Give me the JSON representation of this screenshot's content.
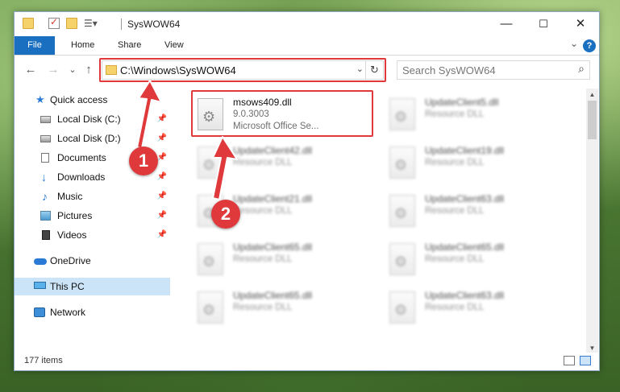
{
  "window": {
    "title": "SysWOW64",
    "minimize": "—",
    "maximize": "☐",
    "close": "✕"
  },
  "ribbon": {
    "tabs": [
      {
        "label": "File"
      },
      {
        "label": "Home"
      },
      {
        "label": "Share"
      },
      {
        "label": "View"
      }
    ],
    "help": "?"
  },
  "nav": {
    "back": "←",
    "forward": "→",
    "recent": "⌄",
    "up": "↑",
    "address": "C:\\Windows\\SysWOW64",
    "refresh": "↻",
    "search_placeholder": "Search SysWOW64",
    "search_icon": "search-icon"
  },
  "sidebar": {
    "items": [
      {
        "label": "Quick access",
        "icon": "star-icon",
        "pinned": false
      },
      {
        "label": "Local Disk (C:)",
        "icon": "drive-icon",
        "pinned": true
      },
      {
        "label": "Local Disk (D:)",
        "icon": "drive-icon",
        "pinned": true
      },
      {
        "label": "Documents",
        "icon": "documents-icon",
        "pinned": true
      },
      {
        "label": "Downloads",
        "icon": "download-icon",
        "pinned": true
      },
      {
        "label": "Music",
        "icon": "music-icon",
        "pinned": true
      },
      {
        "label": "Pictures",
        "icon": "pictures-icon",
        "pinned": true
      },
      {
        "label": "Videos",
        "icon": "videos-icon",
        "pinned": true
      },
      {
        "label": "OneDrive",
        "icon": "cloud-icon",
        "pinned": false
      },
      {
        "label": "This PC",
        "icon": "computer-icon",
        "pinned": false,
        "selected": true
      },
      {
        "label": "Network",
        "icon": "network-icon",
        "pinned": false
      }
    ]
  },
  "files": [
    {
      "name": "msows409.dll",
      "line2": "9.0.3003",
      "line3": "Microsoft Office Se...",
      "highlighted": true
    },
    {
      "name": "UpdateClient5.dll",
      "line2": "Resource DLL",
      "blurred": true
    },
    {
      "name": "UpdateClient42.dll",
      "line2": "Resource DLL",
      "blurred": true
    },
    {
      "name": "UpdateClient19.dll",
      "line2": "Resource DLL",
      "blurred": true
    },
    {
      "name": "UpdateClient21.dll",
      "line2": "Resource DLL",
      "blurred": true
    },
    {
      "name": "UpdateClient63.dll",
      "line2": "Resource DLL",
      "blurred": true
    },
    {
      "name": "UpdateClient65.dll",
      "line2": "Resource DLL",
      "blurred": true
    },
    {
      "name": "UpdateClient65.dll",
      "line2": "Resource DLL",
      "blurred": true
    },
    {
      "name": "UpdateClient65.dll",
      "line2": "Resource DLL",
      "blurred": true
    },
    {
      "name": "UpdateClient63.dll",
      "line2": "Resource DLL",
      "blurred": true
    }
  ],
  "status": {
    "item_count": "177 items"
  },
  "annotations": {
    "step1": "1",
    "step2": "2",
    "color": "#e0393b"
  }
}
